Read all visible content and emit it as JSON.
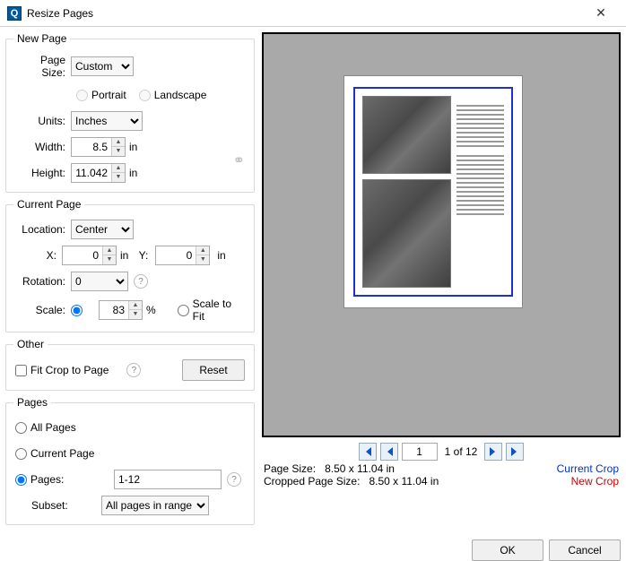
{
  "window": {
    "title": "Resize Pages"
  },
  "newpage": {
    "legend": "New Page",
    "pageSizeLabel": "Page Size:",
    "pageSizeValue": "Custom",
    "portrait": "Portrait",
    "landscape": "Landscape",
    "unitsLabel": "Units:",
    "unitsValue": "Inches",
    "widthLabel": "Width:",
    "widthValue": "8.5",
    "heightLabel": "Height:",
    "heightValue": "11.042",
    "unitSuffix": "in"
  },
  "current": {
    "legend": "Current Page",
    "locationLabel": "Location:",
    "locationValue": "Center",
    "xLabel": "X:",
    "xValue": "0",
    "yLabel": "Y:",
    "yValue": "0",
    "xyUnit": "in",
    "rotationLabel": "Rotation:",
    "rotationValue": "0",
    "scaleLabel": "Scale:",
    "scaleValue": "83",
    "scalePct": "%",
    "scaleToFit": "Scale to Fit"
  },
  "other": {
    "legend": "Other",
    "fitCrop": "Fit Crop to Page",
    "reset": "Reset"
  },
  "pages": {
    "legend": "Pages",
    "all": "All Pages",
    "currentPage": "Current Page",
    "pagesRadio": "Pages:",
    "pagesValue": "1-12",
    "subsetLabel": "Subset:",
    "subsetValue": "All pages in range"
  },
  "preview": {
    "pagerCurrent": "1",
    "pagerTotal": "1 of 12",
    "pageSizeLabel": "Page Size:",
    "pageSizeValue": "8.50 x 11.04 in",
    "croppedLabel": "Cropped Page Size:",
    "croppedValue": "8.50 x 11.04 in",
    "currentCrop": "Current Crop",
    "newCrop": "New Crop"
  },
  "buttons": {
    "ok": "OK",
    "cancel": "Cancel"
  }
}
